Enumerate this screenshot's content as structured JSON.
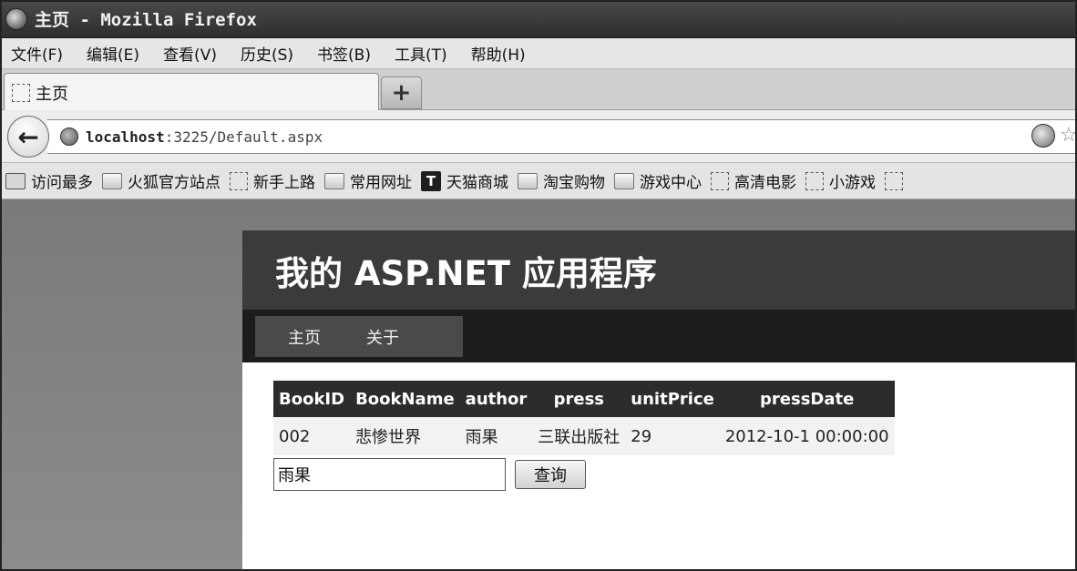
{
  "window": {
    "title": "主页 - Mozilla Firefox"
  },
  "menubar": {
    "items": [
      "文件(F)",
      "编辑(E)",
      "查看(V)",
      "历史(S)",
      "书签(B)",
      "工具(T)",
      "帮助(H)"
    ]
  },
  "tabs": {
    "active_label": "主页",
    "new_tab_label": "+"
  },
  "navbar": {
    "url_host": "localhost",
    "url_rest": ":3225/Default.aspx"
  },
  "bookmarks": [
    {
      "label": "访问最多",
      "icon": "search-icon"
    },
    {
      "label": "火狐官方站点",
      "icon": "folder-icon"
    },
    {
      "label": "新手上路",
      "icon": "page-icon"
    },
    {
      "label": "常用网址",
      "icon": "folder-icon"
    },
    {
      "label": "天猫商城",
      "icon": "tmall-icon"
    },
    {
      "label": "淘宝购物",
      "icon": "folder-icon"
    },
    {
      "label": "游戏中心",
      "icon": "folder-icon"
    },
    {
      "label": "高清电影",
      "icon": "page-icon"
    },
    {
      "label": "小游戏",
      "icon": "page-icon"
    }
  ],
  "site": {
    "title": "我的 ASP.NET 应用程序",
    "menu": [
      "主页",
      "关于"
    ]
  },
  "grid": {
    "headers": [
      "BookID",
      "BookName",
      "author",
      "press",
      "unitPrice",
      "pressDate"
    ],
    "rows": [
      [
        "002",
        "悲惨世界",
        "雨果",
        "三联出版社",
        "29",
        "2012-10-1 00:00:00"
      ]
    ]
  },
  "search": {
    "value": "雨果",
    "button_label": "查询"
  }
}
